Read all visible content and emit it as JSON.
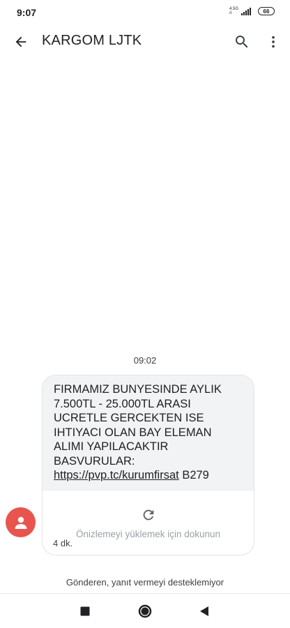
{
  "status_bar": {
    "time": "9:07",
    "network_top": "4.5G",
    "network_bottom": "ıl",
    "battery": "66"
  },
  "app_bar": {
    "title": "KARGOM LJTK",
    "icons": [
      "arrow-back-icon",
      "search-icon",
      "more-vert-icon"
    ]
  },
  "conversation": {
    "timestamp": "09:02",
    "message": {
      "text_before_link": "FIRMAMIZ BUNYESINDE AYLIK 7.500TL - 25.000TL ARASI UCRETLE GERCEKTEN ISE IHTIYACI OLAN BAY ELEMAN ALIMI YAPILACAKTIR BASVURULAR: ",
      "link": "https://pvp.tc/kurumfirsat",
      "text_after_link": " B279"
    },
    "preview_label": "Önizlemeyi yüklemek için dokunun",
    "age": "4 dk.",
    "avatar_color": "#e8554e"
  },
  "footer": {
    "reply_note": "Gönderen, yanıt vermeyi desteklemiyor"
  },
  "nav_bar": {
    "icons": [
      "recents-square-icon",
      "home-circle-icon",
      "back-triangle-icon"
    ]
  }
}
